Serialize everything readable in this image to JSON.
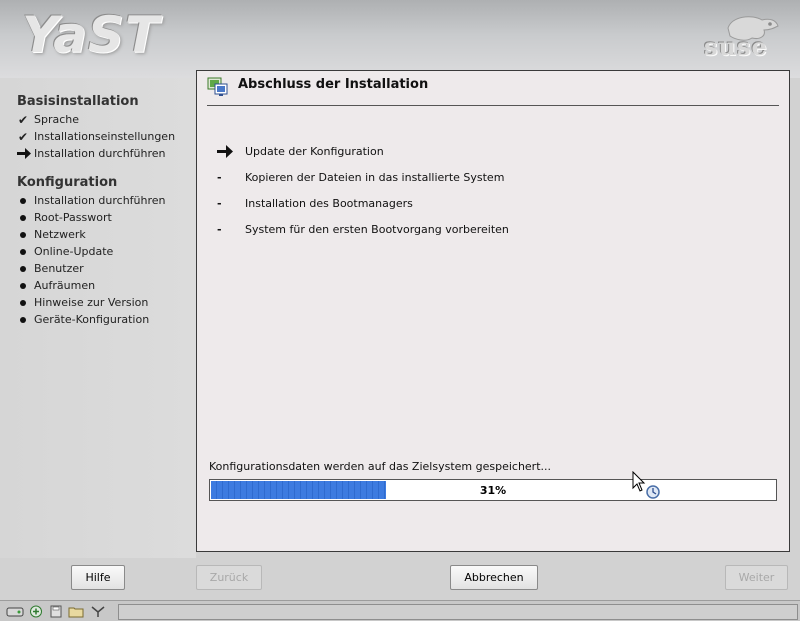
{
  "header": {
    "app_logo": "YaST",
    "brand_logo": "suse"
  },
  "sidebar": {
    "section1_heading": "Basisinstallation",
    "section1_items": [
      {
        "label": "Sprache",
        "status": "done"
      },
      {
        "label": "Installationseinstellungen",
        "status": "done"
      },
      {
        "label": "Installation durchführen",
        "status": "current"
      }
    ],
    "section2_heading": "Konfiguration",
    "section2_items": [
      {
        "label": "Installation durchführen",
        "status": "pending"
      },
      {
        "label": "Root-Passwort",
        "status": "pending"
      },
      {
        "label": "Netzwerk",
        "status": "pending"
      },
      {
        "label": "Online-Update",
        "status": "pending"
      },
      {
        "label": "Benutzer",
        "status": "pending"
      },
      {
        "label": "Aufräumen",
        "status": "pending"
      },
      {
        "label": "Hinweise zur Version",
        "status": "pending"
      },
      {
        "label": "Geräte-Konfiguration",
        "status": "pending"
      }
    ]
  },
  "panel": {
    "title": "Abschluss der Installation",
    "steps": [
      {
        "label": "Update der Konfiguration",
        "status": "current"
      },
      {
        "label": "Kopieren der Dateien in das installierte System",
        "status": "pending"
      },
      {
        "label": "Installation des Bootmanagers",
        "status": "pending"
      },
      {
        "label": "System für den ersten Bootvorgang vorbereiten",
        "status": "pending"
      }
    ],
    "progress_label": "Konfigurationsdaten werden auf das Zielsystem gespeichert...",
    "progress_value": 31,
    "progress_text": "31%"
  },
  "buttons": {
    "help": "Hilfe",
    "back": "Zurück",
    "abort": "Abbrechen",
    "next": "Weiter"
  },
  "colors": {
    "progress_fill": "#3d7be0",
    "panel_background": "#eeeaeb"
  },
  "icons": {
    "done": "checkmark-icon",
    "current": "arrow-right-icon",
    "pending": "bullet-icon",
    "step_pending": "dash-icon"
  }
}
